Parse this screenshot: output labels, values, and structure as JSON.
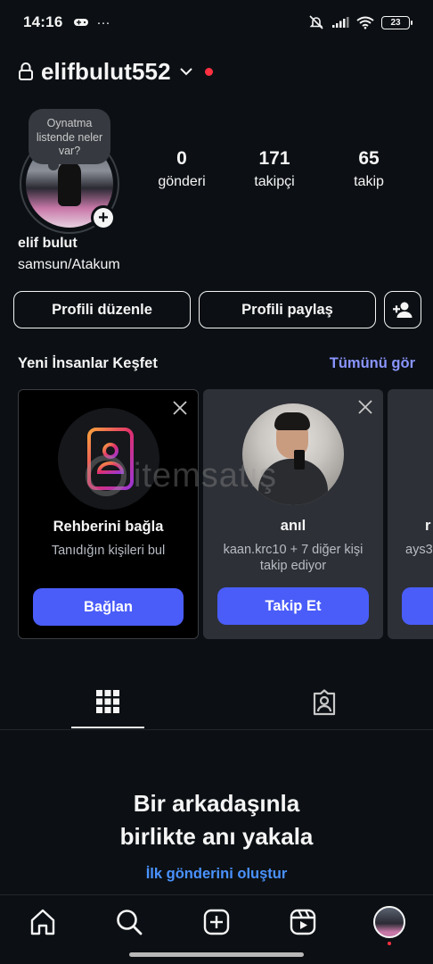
{
  "status_bar": {
    "time": "14:16",
    "battery": "23",
    "more_indicator": "···"
  },
  "profile": {
    "username": "elifbulut552",
    "note": "Oynatma listende neler var?",
    "full_name": "elif bulut",
    "bio": "samsun/Atakum",
    "stats": [
      {
        "value": "0",
        "label": "gönderi"
      },
      {
        "value": "171",
        "label": "takipçi"
      },
      {
        "value": "65",
        "label": "takip"
      }
    ]
  },
  "buttons": {
    "edit_profile": "Profili düzenle",
    "share_profile": "Profili paylaş"
  },
  "discover": {
    "title": "Yeni İnsanlar Keşfet",
    "see_all": "Tümünü gör",
    "cards": [
      {
        "title": "Rehberini bağla",
        "subtitle": "Tanıdığın kişileri bul",
        "button": "Bağlan"
      },
      {
        "title": "anıl",
        "subtitle": "kaan.krc10 + 7 diğer kişi takip ediyor",
        "button": "Takip Et"
      },
      {
        "title": "r",
        "subtitle": "ays3"
      }
    ]
  },
  "watermark": "itemsatış",
  "empty_state": {
    "title": "Bir arkadaşınla birlikte anı yakala",
    "link": "İlk gönderini oluştur"
  },
  "colors": {
    "background": "#0c1014",
    "accent": "#4a5df9",
    "link": "#4a92ff",
    "see_all": "#8a95ff",
    "notification": "#ff3040"
  },
  "icons": [
    "lock-icon",
    "chevron-down-icon",
    "add-person-icon",
    "close-icon",
    "contacts-book-icon",
    "grid-icon",
    "tagged-icon",
    "home-icon",
    "search-icon",
    "create-icon",
    "reels-icon"
  ]
}
